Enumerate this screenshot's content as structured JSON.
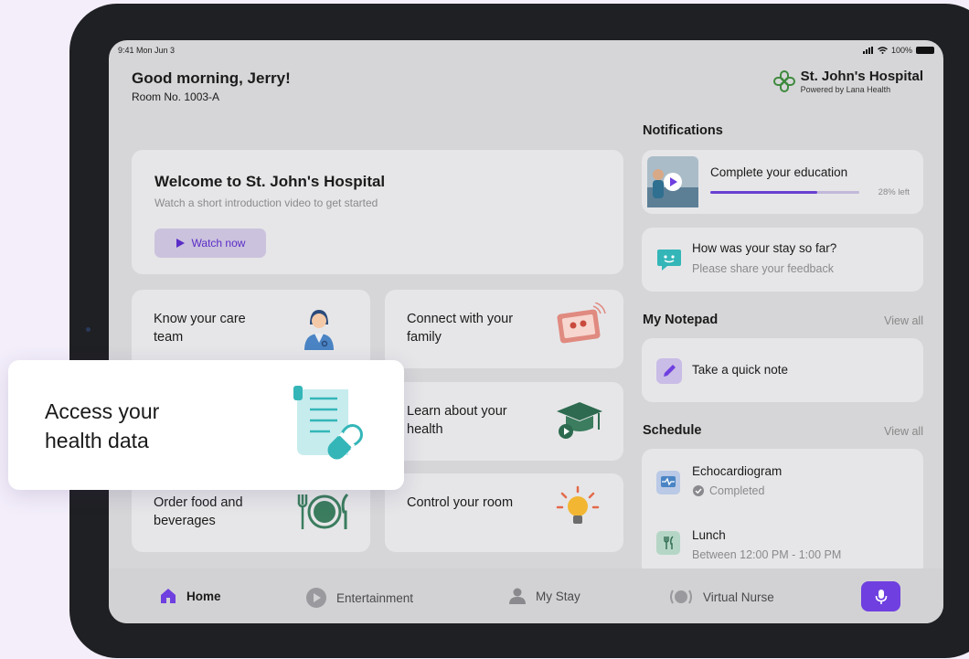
{
  "status_bar": {
    "time": "9:41 Mon Jun 3",
    "battery": "100%"
  },
  "header": {
    "greeting": "Good morning, Jerry!",
    "room": "Room No. 1003-A"
  },
  "brand": {
    "name": "St. John's Hospital",
    "powered_by": "Powered by Lana Health"
  },
  "welcome": {
    "title": "Welcome to St. John's Hospital",
    "subtitle": "Watch a short introduction video to get started",
    "button_label": "Watch now"
  },
  "tiles": [
    {
      "label": "Know your care team",
      "icon": "nurse-icon"
    },
    {
      "label": "Connect with your family",
      "icon": "video-call-icon"
    },
    {
      "label": "Learn about your health",
      "icon": "graduation-cap-icon"
    },
    {
      "label": "Order food and beverages",
      "icon": "plate-cutlery-icon"
    },
    {
      "label": "Control your room",
      "icon": "light-bulb-icon"
    }
  ],
  "notifications": {
    "title": "Notifications",
    "education": {
      "label": "Complete your education",
      "progress_text": "28% left",
      "progress": 0.72
    },
    "feedback": {
      "title": "How was your stay so far?",
      "subtitle": "Please share your feedback"
    }
  },
  "notepad": {
    "title": "My Notepad",
    "view_all": "View all",
    "note_label": "Take a quick note"
  },
  "schedule": {
    "title": "Schedule",
    "view_all": "View all",
    "items": [
      {
        "title": "Echocardiogram",
        "subtitle": "Completed"
      },
      {
        "title": "Lunch",
        "subtitle": "Between 12:00 PM - 1:00 PM"
      }
    ]
  },
  "nav": {
    "items": [
      {
        "label": "Home",
        "icon": "home-icon"
      },
      {
        "label": "Entertainment",
        "icon": "play-icon"
      },
      {
        "label": "My Stay",
        "icon": "person-icon"
      },
      {
        "label": "Virtual Nurse",
        "icon": "virtual-nurse-icon"
      }
    ],
    "mic_icon": "microphone-icon"
  },
  "popout": {
    "label": "Access your health data",
    "icon": "health-record-icon"
  },
  "colors": {
    "accent": "#6f3fe0",
    "teal": "#34b6b8",
    "orange": "#e36a4a"
  }
}
